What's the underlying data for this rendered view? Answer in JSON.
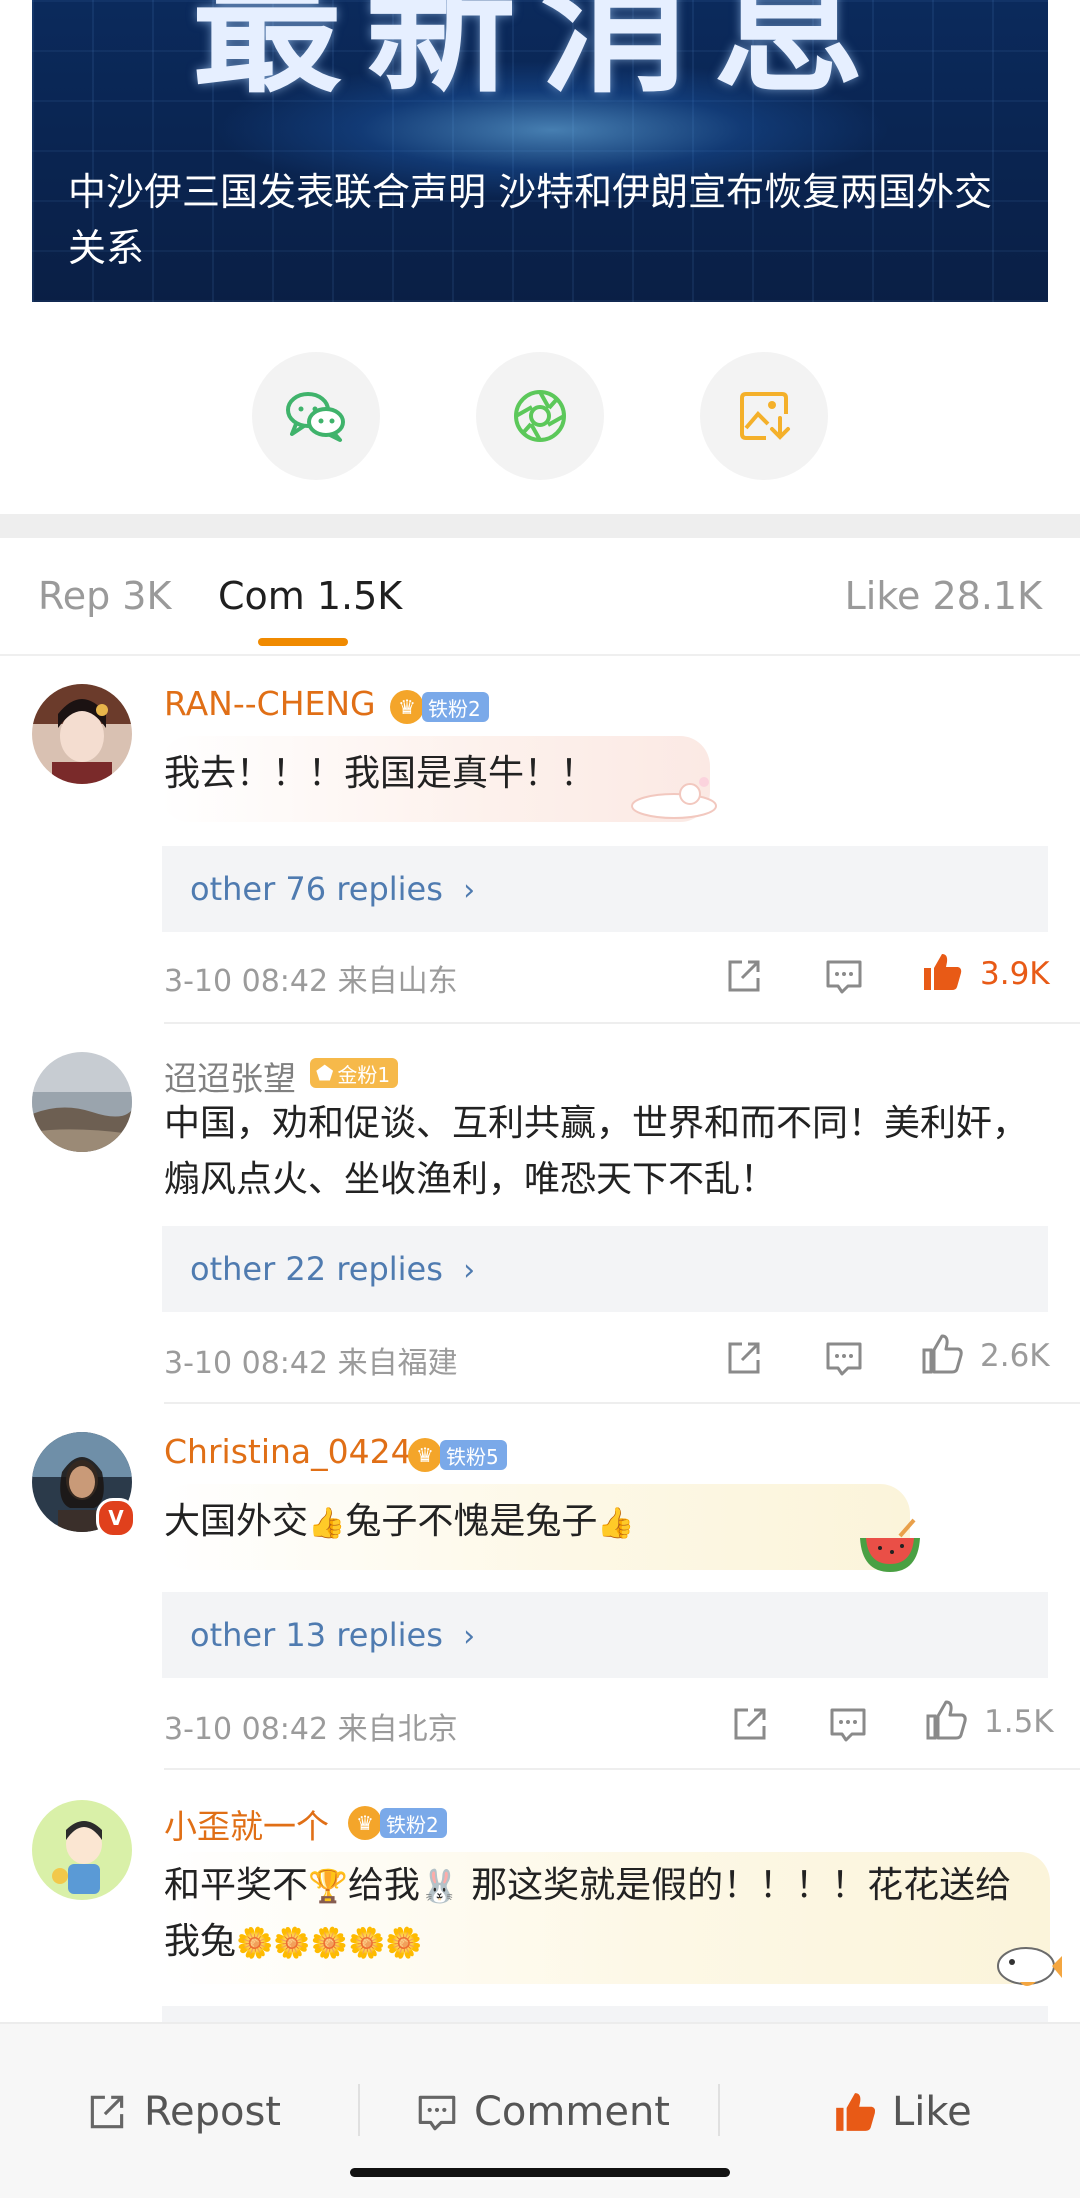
{
  "banner": {
    "big_text": "最新消息",
    "headline": "中沙伊三国发表联合声明 沙特和伊朗宣布恢复两国外交关系"
  },
  "share": [
    {
      "icon": "wechat-icon",
      "color": "#3fb36b"
    },
    {
      "icon": "moments-icon",
      "color": "#5cc85a"
    },
    {
      "icon": "save-image-icon",
      "color": "#f4b02a"
    }
  ],
  "tabs": {
    "repost": "Rep 3K",
    "comments": "Com 1.5K",
    "likes": "Like 28.1K"
  },
  "comments": [
    {
      "username": "RAN--CHENG",
      "badge": "铁粉2",
      "text": "我去！！！我国是真牛！！",
      "replies": "other 76 replies",
      "meta": "3-10 08:42 来自山东",
      "likes": "3.9K",
      "liked": true
    },
    {
      "username": "迢迢张望",
      "badge": "金粉1",
      "text": "中国，劝和促谈、互利共赢，世界和而不同！美利奸，煽风点火、坐收渔利，唯恐天下不乱！",
      "replies": "other 22 replies",
      "meta": "3-10 08:42 来自福建",
      "likes": "2.6K",
      "liked": false
    },
    {
      "username": "Christina_0424",
      "badge": "铁粉5",
      "text_parts": [
        "大国外交",
        "兔子不愧是兔子"
      ],
      "thumb_emoji": "👍",
      "replies": "other 13 replies",
      "meta": "3-10 08:42 来自北京",
      "likes": "1.5K",
      "liked": false
    },
    {
      "username": "小歪就一个",
      "badge": "铁粉2",
      "text_parts": [
        "和平奖不",
        "给我",
        "那这奖就是假的！！！！花花送给我兔"
      ],
      "trophy_emoji": "🏆",
      "rabbit_emoji": "🐰",
      "flower_emoji": "🌼🌼🌼🌼🌼"
    }
  ],
  "bottom_bar": {
    "repost": "Repost",
    "comment": "Comment",
    "like": "Like"
  },
  "colors": {
    "accent": "#f08a00",
    "username": "#e06f16",
    "link": "#4f7bb0",
    "like_active": "#e85a16"
  }
}
